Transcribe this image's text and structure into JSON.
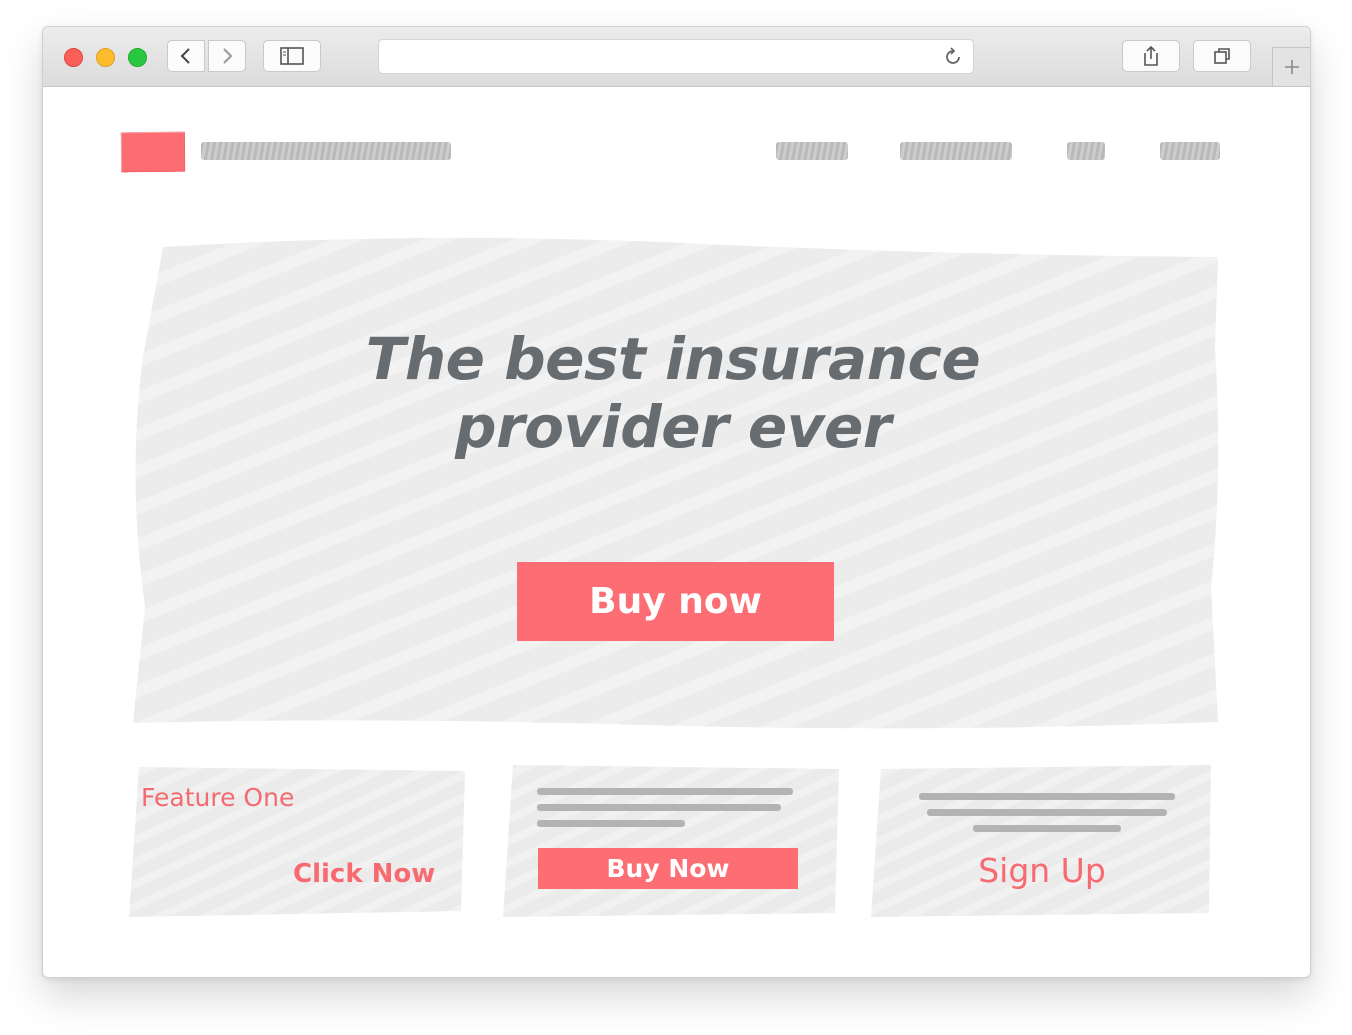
{
  "browser": {
    "icons": {
      "back": "chevron-left-icon",
      "forward": "chevron-right-icon",
      "sidebar": "sidebar-icon",
      "reload": "reload-icon",
      "share": "share-icon",
      "tabs": "tabs-icon",
      "new_tab": "plus-icon"
    }
  },
  "hero": {
    "title_line1": "The best insurance",
    "title_line2": "provider ever",
    "button_label": "Buy now"
  },
  "features": [
    {
      "title": "Feature One",
      "link_label": "Click Now"
    },
    {
      "button_label": "Buy Now"
    },
    {
      "link_label": "Sign Up"
    }
  ],
  "colors": {
    "accent": "#fd6d74",
    "heading": "#666c70",
    "scribble": "#efefef",
    "placeholder_bar": "#bdbdbd"
  }
}
